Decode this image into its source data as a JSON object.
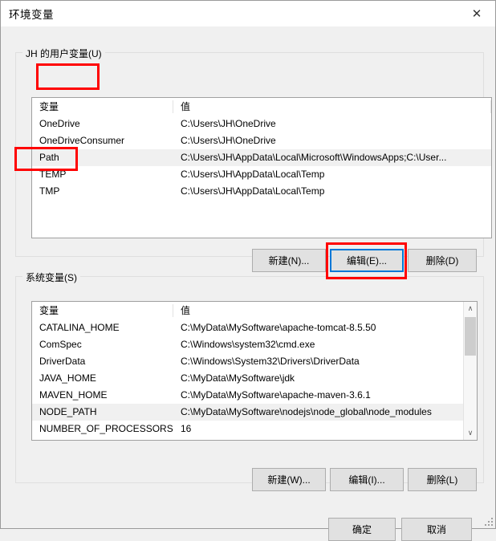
{
  "window": {
    "title": "环境变量",
    "close_icon": "close-icon",
    "close_glyph": "✕"
  },
  "colors": {
    "accent": "#0078d7",
    "annotation": "#ff0000",
    "dialog_bg": "#f0f0f0",
    "list_bg": "#ffffff",
    "selected_row": "#f0f0f0"
  },
  "user_section": {
    "legend": "JH 的用户变量(U)",
    "columns": [
      "变量",
      "值"
    ],
    "rows": [
      {
        "name": "OneDrive",
        "value": "C:\\Users\\JH\\OneDrive",
        "selected": false
      },
      {
        "name": "OneDriveConsumer",
        "value": "C:\\Users\\JH\\OneDrive",
        "selected": false
      },
      {
        "name": "Path",
        "value": "C:\\Users\\JH\\AppData\\Local\\Microsoft\\WindowsApps;C:\\User...",
        "selected": true
      },
      {
        "name": "TEMP",
        "value": "C:\\Users\\JH\\AppData\\Local\\Temp",
        "selected": false
      },
      {
        "name": "TMP",
        "value": "C:\\Users\\JH\\AppData\\Local\\Temp",
        "selected": false
      }
    ],
    "buttons": {
      "new": "新建(N)...",
      "edit": "编辑(E)...",
      "delete": "删除(D)"
    }
  },
  "system_section": {
    "legend": "系统变量(S)",
    "columns": [
      "变量",
      "值"
    ],
    "rows": [
      {
        "name": "CATALINA_HOME",
        "value": "C:\\MyData\\MySoftware\\apache-tomcat-8.5.50",
        "selected": false
      },
      {
        "name": "ComSpec",
        "value": "C:\\Windows\\system32\\cmd.exe",
        "selected": false
      },
      {
        "name": "DriverData",
        "value": "C:\\Windows\\System32\\Drivers\\DriverData",
        "selected": false
      },
      {
        "name": "JAVA_HOME",
        "value": "C:\\MyData\\MySoftware\\jdk",
        "selected": false
      },
      {
        "name": "MAVEN_HOME",
        "value": "C:\\MyData\\MySoftware\\apache-maven-3.6.1",
        "selected": false
      },
      {
        "name": "NODE_PATH",
        "value": "C:\\MyData\\MySoftware\\nodejs\\node_global\\node_modules",
        "selected": true
      },
      {
        "name": "NUMBER_OF_PROCESSORS",
        "value": "16",
        "selected": false
      }
    ],
    "buttons": {
      "new": "新建(W)...",
      "edit": "编辑(I)...",
      "delete": "删除(L)"
    },
    "scrollbar": {
      "up_glyph": "∧",
      "down_glyph": "∨"
    }
  },
  "footer": {
    "ok": "确定",
    "cancel": "取消"
  }
}
